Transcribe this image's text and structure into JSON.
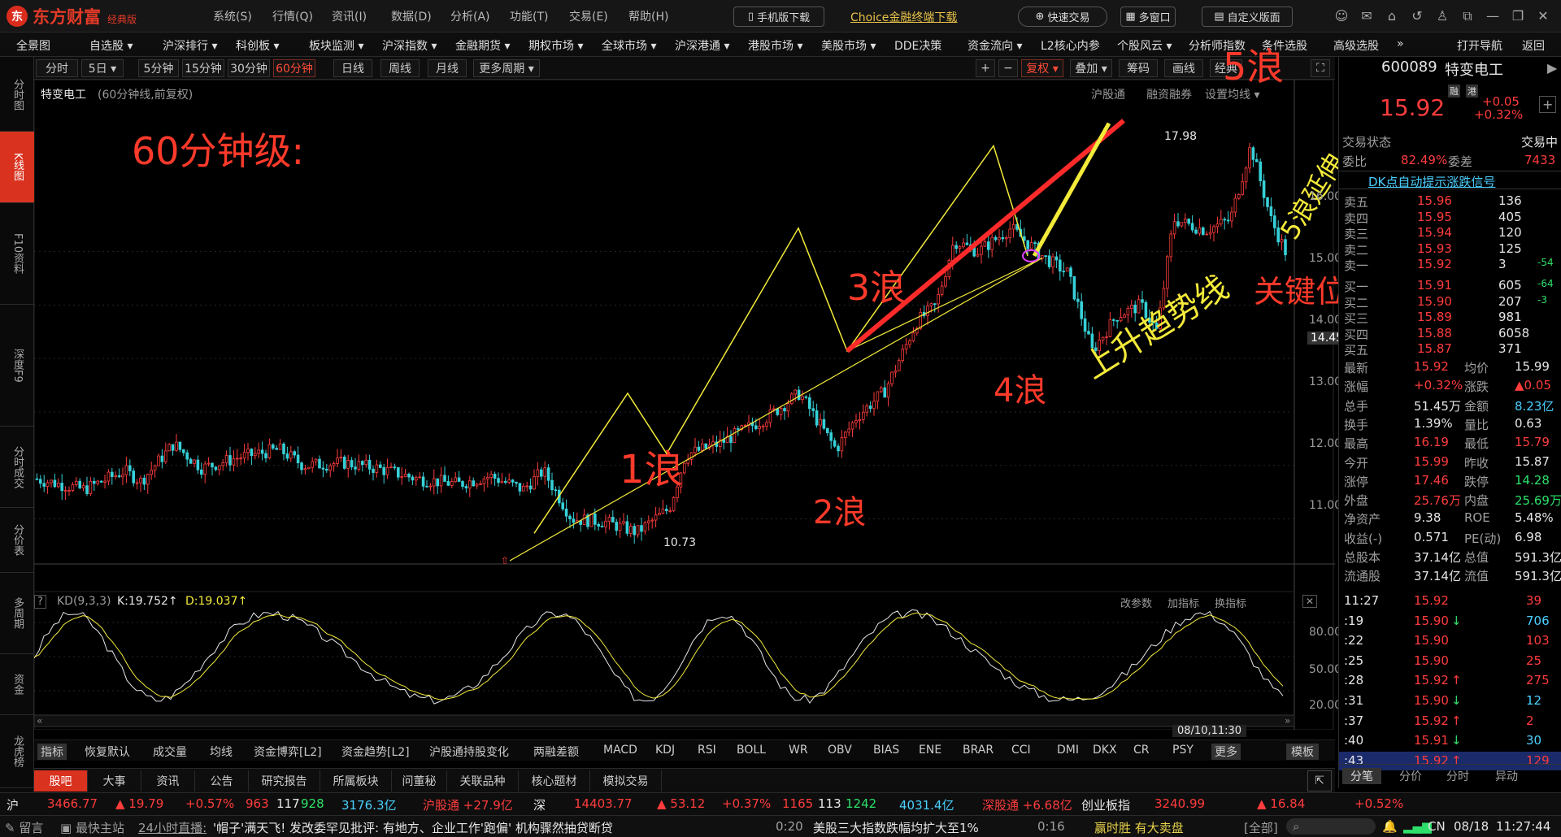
{
  "app": {
    "logo_mark": "东",
    "name": "东方财富",
    "edition": "经典版"
  },
  "menu": [
    "系统(S)",
    "行情(Q)",
    "资讯(I)",
    "数据(D)",
    "分析(A)",
    "功能(T)",
    "交易(E)",
    "帮助(H)"
  ],
  "top_buttons": {
    "mobile": "手机版下载",
    "choice": "Choice金融终端下载",
    "quick_trade": "快速交易",
    "multi_window": "多窗口",
    "custom_page": "自定义版面"
  },
  "nav": [
    "全景图",
    "自选股 ▾",
    "沪深排行 ▾",
    "科创板 ▾",
    "板块监测 ▾",
    "沪深指数 ▾",
    "金融期货 ▾",
    "期权市场 ▾",
    "全球市场 ▾",
    "沪深港通 ▾",
    "港股市场 ▾",
    "美股市场 ▾",
    "DDE决策",
    "资金流向 ▾",
    "L2核心内参",
    "个股风云 ▾",
    "分析师指数",
    "条件选股",
    "高级选股",
    "»",
    "打开导航",
    "返回"
  ],
  "left_tabs": [
    "分时图",
    "K线图",
    "F10资料",
    "深度F9",
    "分时成交",
    "分价表",
    "多周期",
    "资金",
    "龙虎榜"
  ],
  "period": {
    "items": [
      "分时",
      "5日 ▾",
      "5分钟",
      "15分钟",
      "30分钟",
      "60分钟",
      "日线",
      "周线",
      "月线",
      "更多周期 ▾"
    ],
    "right": [
      "+",
      "−",
      "复权 ▾",
      "叠加 ▾",
      "筹码",
      "画线",
      "经典"
    ]
  },
  "chart_header": {
    "stock": "特变电工",
    "mode": "(60分钟线,前复权)",
    "links": [
      "沪股通",
      "融资融券",
      "设置均线 ▾"
    ]
  },
  "annotations": {
    "title": "60分钟级:",
    "w1": "1浪",
    "w2": "2浪",
    "w3": "3浪",
    "w4": "4浪",
    "w5": "5浪",
    "ext": "5浪延伸",
    "key": "关键位",
    "trend": "上升趋势线",
    "high": "17.98",
    "low": "10.73"
  },
  "chart_data": {
    "type": "candlestick",
    "ylim": [
      10.4,
      18.7
    ],
    "yticks": [
      "16.00",
      "15.00",
      "14.00",
      "13.00",
      "12.00",
      "11.00"
    ],
    "current_price_label": "14.45",
    "wave_points": [
      10.73,
      13.35,
      12.22,
      16.44,
      14.14,
      17.98,
      15.92
    ],
    "kd": {
      "label": "KD(9,3,3)",
      "k": "K:19.752↑",
      "d": "D:19.037↑",
      "yticks": [
        "80.00",
        "50.00",
        "20.00"
      ],
      "links": [
        "改参数",
        "加指标",
        "换指标"
      ]
    },
    "date_label": "08/10,11:30"
  },
  "stock": {
    "code": "600089",
    "name": "特变电工",
    "tag1": "融",
    "tag2": "港",
    "price": "15.92",
    "chg": "+0.05",
    "pct": "+0.32%",
    "status_label": "交易状态",
    "status": "交易中",
    "wb_label": "委比",
    "wb": "82.49%",
    "wc_label": "委差",
    "wc": "7433",
    "signal": "DK点自动提示涨跌信号"
  },
  "asks": [
    [
      "卖五",
      "15.96",
      "136",
      ""
    ],
    [
      "卖四",
      "15.95",
      "405",
      ""
    ],
    [
      "卖三",
      "15.94",
      "120",
      ""
    ],
    [
      "卖二",
      "15.93",
      "125",
      ""
    ],
    [
      "卖一",
      "15.92",
      "3",
      "-54"
    ]
  ],
  "bids": [
    [
      "买一",
      "15.91",
      "605",
      "-64"
    ],
    [
      "买二",
      "15.90",
      "207",
      "-3"
    ],
    [
      "买三",
      "15.89",
      "981",
      ""
    ],
    [
      "买四",
      "15.88",
      "6058",
      ""
    ],
    [
      "买五",
      "15.87",
      "371",
      ""
    ]
  ],
  "quote": [
    [
      "最新",
      "15.92",
      "均价",
      "15.99"
    ],
    [
      "涨幅",
      "+0.32%",
      "涨跌",
      "▲0.05"
    ],
    [
      "总手",
      "51.45万",
      "金额",
      "8.23亿"
    ],
    [
      "换手",
      "1.39%",
      "量比",
      "0.63"
    ],
    [
      "最高",
      "16.19",
      "最低",
      "15.79"
    ],
    [
      "今开",
      "15.99",
      "昨收",
      "15.87"
    ],
    [
      "涨停",
      "17.46",
      "跌停",
      "14.28"
    ],
    [
      "外盘",
      "25.76万",
      "内盘",
      "25.69万"
    ],
    [
      "净资产",
      "9.38",
      "ROE",
      "5.48%"
    ],
    [
      "收益(-)",
      "0.571",
      "PE(动)",
      "6.98"
    ],
    [
      "总股本",
      "37.14亿",
      "总值",
      "591.3亿"
    ],
    [
      "流通股",
      "37.14亿",
      "流值",
      "591.3亿"
    ]
  ],
  "ticks": [
    [
      "11:27",
      "15.92",
      "",
      "39"
    ],
    [
      ":19",
      "15.90",
      "↓",
      "706"
    ],
    [
      ":22",
      "15.90",
      "",
      "103"
    ],
    [
      ":25",
      "15.90",
      "",
      "25"
    ],
    [
      ":28",
      "15.92",
      "↑",
      "275"
    ],
    [
      ":31",
      "15.90",
      "↓",
      "12"
    ],
    [
      ":37",
      "15.92",
      "↑",
      "2"
    ],
    [
      ":40",
      "15.91",
      "↓",
      "30"
    ],
    [
      ":43",
      "15.92",
      "↑",
      "129"
    ]
  ],
  "rp_tabs": [
    "分笔",
    "分价",
    "分时",
    "异动"
  ],
  "indicators": [
    "指标",
    "恢复默认",
    "成交量",
    "均线",
    "资金博弈[L2]",
    "资金趋势[L2]",
    "沪股通持股变化",
    "两融差额",
    "MACD",
    "KDJ",
    "RSI",
    "BOLL",
    "WR",
    "OBV",
    "BIAS",
    "ENE",
    "BRAR",
    "CCI",
    "DMI",
    "DKX",
    "CR",
    "PSY",
    "更多",
    "模板"
  ],
  "bottom_tabs": [
    "股吧",
    "大事",
    "资讯",
    "公告",
    "研究报告",
    "所属板块",
    "问董秘",
    "关联品种",
    "核心题材",
    "模拟交易"
  ],
  "index_bar": {
    "sh": "沪",
    "sh_val": "3466.77",
    "sh_chg": "▲ 19.79",
    "sh_pct": "+0.57%",
    "sh_up": "963",
    "sh_flat": "117",
    "sh_dn": "928",
    "sh_amt": "3176.3亿",
    "hgt": "沪股通 +27.9亿",
    "sz": "深",
    "sz_val": "14403.77",
    "sz_chg": "▲ 53.12",
    "sz_pct": "+0.37%",
    "sz_up": "1165",
    "sz_flat": "113",
    "sz_dn": "1242",
    "sz_amt": "4031.4亿",
    "sgt": "深股通 +6.68亿",
    "cyb": "创业板指",
    "cyb_val": "3240.99",
    "cyb_chg": "▲ 16.84",
    "cyb_pct": "+0.52%"
  },
  "news": {
    "msg": "留言",
    "kf": "最快主站",
    "live": "24小时直播:",
    "t1": "'帽子'满天飞! 发改委罕见批评: 有地方、企业工作'跑偏' 机构骤然抽贷断贷",
    "time1": "0:20",
    "t2": "美股三大指数跌幅均扩大至1%",
    "time2": "0:16",
    "ad": "赢时胜 有大卖盘",
    "all": "[全部]",
    "region": "CN",
    "date": "08/18",
    "clock": "11:27:44"
  }
}
